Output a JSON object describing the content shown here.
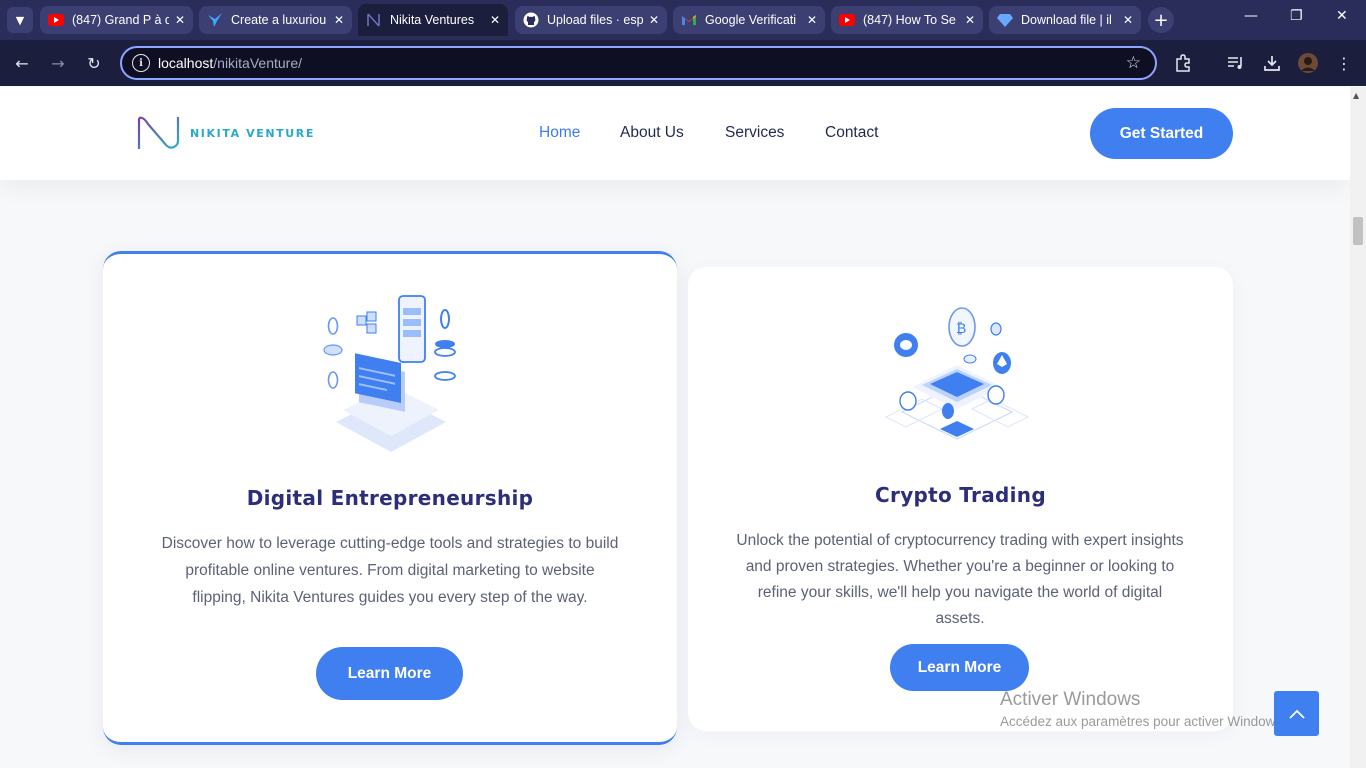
{
  "browser": {
    "tabs": [
      {
        "title": "(847) Grand P à d",
        "icon": "youtube-icon"
      },
      {
        "title": "Create a luxuriou",
        "icon": "bird-icon"
      },
      {
        "title": "Nikita Ventures",
        "icon": "nikita-logo-icon",
        "active": true
      },
      {
        "title": "Upload files · esp",
        "icon": "github-icon"
      },
      {
        "title": "Google Verificati",
        "icon": "gmail-icon"
      },
      {
        "title": "(847) How To Se",
        "icon": "youtube-icon"
      },
      {
        "title": "Download file | il",
        "icon": "diamond-icon"
      }
    ],
    "url_host": "localhost",
    "url_path": "/nikitaVenture/"
  },
  "colors": {
    "accent": "#3f7ff0",
    "title": "#2d2e7a",
    "chrome": "#2a2d5a"
  },
  "nav": {
    "logo_text": "NIKITA VENTURE",
    "links": [
      "Home",
      "About Us",
      "Services",
      "Contact"
    ],
    "active": "Home",
    "cta": "Get Started"
  },
  "cards": [
    {
      "title": "Digital Entrepreneurship",
      "text": "Discover how to leverage cutting-edge tools and strategies to build profitable online ventures. From digital marketing to website flipping, Nikita Ventures guides you every step of the way.",
      "button": "Learn More"
    },
    {
      "title": "Crypto Trading",
      "text": "Unlock the potential of cryptocurrency trading with expert insights and proven strategies. Whether you're a beginner or looking to refine your skills, we'll help you navigate the world of digital assets.",
      "button": "Learn More"
    }
  ],
  "watermark": {
    "line1": "Activer Windows",
    "line2": "Accédez aux paramètres pour activer Windows."
  }
}
